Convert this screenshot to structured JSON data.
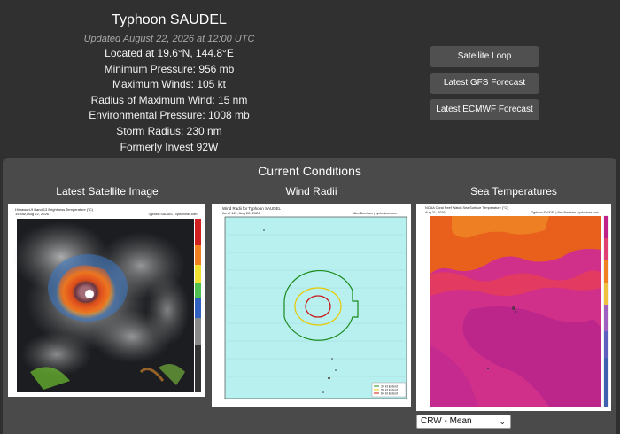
{
  "storm": {
    "title": "Typhoon SAUDEL",
    "updated": "Updated August 22, 2026 at 12:00 UTC",
    "lines": [
      "Located at 19.6°N, 144.8°E",
      "Minimum Pressure: 956 mb",
      "Maximum Winds: 105 kt",
      "Radius of Maximum Wind: 15 nm",
      "Environmental Pressure: 1008 mb",
      "Storm Radius: 230 nm",
      "Formerly Invest 92W"
    ]
  },
  "buttons": {
    "satellite_loop": "Satellite Loop",
    "gfs": "Latest GFS Forecast",
    "ecmwf": "Latest ECMWF Forecast"
  },
  "conditions": {
    "title": "Current Conditions",
    "satellite": {
      "title": "Latest Satellite Image",
      "caption1": "Himawari-9 Band 13 Brightness Temperature (°C)",
      "caption2": "15:45z, Aug 22, 2026",
      "caption3": "Typhoon SAUDEL | cyclonicwx.com"
    },
    "wind": {
      "title": "Wind Radii",
      "caption1": "Wind Radii for Typhoon SAUDEL",
      "caption2": "As of 12z, Aug 22, 2026",
      "caption3": "Alex Boreham | cyclonicwx.com",
      "legend": [
        "34 kt Extent",
        "50 kt Extent",
        "64 kt Extent"
      ],
      "colors": [
        "#1a8a1a",
        "#e8c800",
        "#c81818"
      ]
    },
    "sst": {
      "title": "Sea Temperatures",
      "caption1": "NOAA Coral Reef Watch Sea Surface Temperature (°C)",
      "caption2": "Aug 21, 2026",
      "caption3": "Typhoon SAUDEL | Alex Boreham | cyclonicwx.com",
      "select_value": "CRW - Mean"
    }
  }
}
